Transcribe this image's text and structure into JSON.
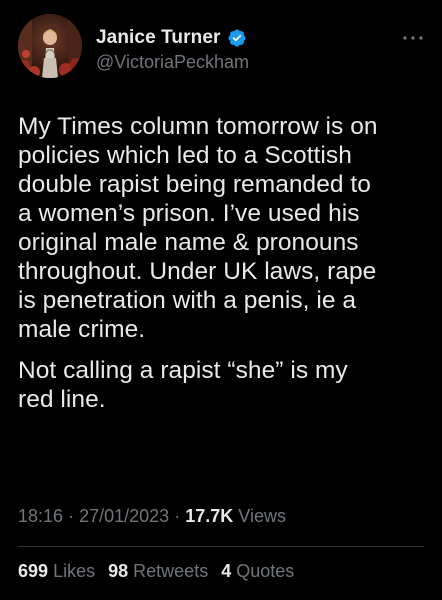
{
  "author": {
    "display_name": "Janice Turner",
    "handle": "@VictoriaPeckham",
    "verified_color": "#1d9bf0"
  },
  "tweet": {
    "paragraphs": [
      "My Times column tomorrow is on\npolicies which led to a Scottish\ndouble rapist being remanded to\na women’s prison. I’ve used his\noriginal male name & pronouns\nthroughout. Under UK laws, rape\nis penetration with a penis, ie a\nmale crime.",
      "Not calling a rapist “she” is my\nred line."
    ]
  },
  "meta": {
    "time": "18:16",
    "separator_1": "·",
    "date": "27/01/2023",
    "separator_2": "·",
    "views_count": "17.7K",
    "views_label": "Views"
  },
  "stats": {
    "likes_count": "699",
    "likes_label": "Likes",
    "retweets_count": "98",
    "retweets_label": "Retweets",
    "quotes_count": "4",
    "quotes_label": "Quotes"
  },
  "icons": {
    "verified": "verified-badge-icon",
    "more": "more-options-icon"
  },
  "colors": {
    "background": "#000000",
    "text": "#e7e9ea",
    "muted": "#71767b",
    "divider": "#2f3336",
    "accent": "#1d9bf0"
  }
}
